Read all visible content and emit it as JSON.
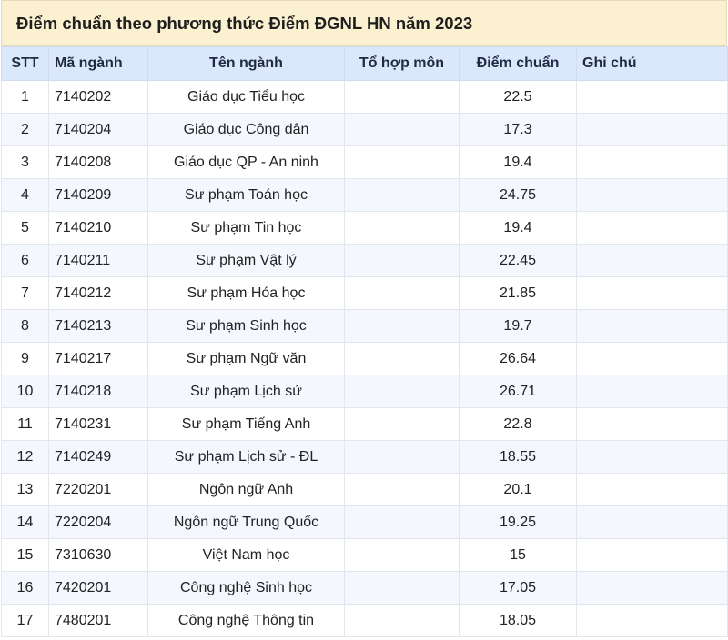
{
  "title": "Điểm chuẩn theo phương thức Điểm ĐGNL HN năm 2023",
  "columns": [
    "STT",
    "Mã ngành",
    "Tên ngành",
    "Tổ hợp môn",
    "Điểm chuẩn",
    "Ghi chú"
  ],
  "rows": [
    {
      "stt": "1",
      "code": "7140202",
      "name": "Giáo dục Tiểu học",
      "combo": "",
      "score": "22.5",
      "note": ""
    },
    {
      "stt": "2",
      "code": "7140204",
      "name": "Giáo dục Công dân",
      "combo": "",
      "score": "17.3",
      "note": ""
    },
    {
      "stt": "3",
      "code": "7140208",
      "name": "Giáo dục QP - An ninh",
      "combo": "",
      "score": "19.4",
      "note": ""
    },
    {
      "stt": "4",
      "code": "7140209",
      "name": "Sư phạm Toán học",
      "combo": "",
      "score": "24.75",
      "note": ""
    },
    {
      "stt": "5",
      "code": "7140210",
      "name": "Sư phạm Tin học",
      "combo": "",
      "score": "19.4",
      "note": ""
    },
    {
      "stt": "6",
      "code": "7140211",
      "name": "Sư phạm Vật lý",
      "combo": "",
      "score": "22.45",
      "note": ""
    },
    {
      "stt": "7",
      "code": "7140212",
      "name": "Sư phạm Hóa học",
      "combo": "",
      "score": "21.85",
      "note": ""
    },
    {
      "stt": "8",
      "code": "7140213",
      "name": "Sư phạm Sinh học",
      "combo": "",
      "score": "19.7",
      "note": ""
    },
    {
      "stt": "9",
      "code": "7140217",
      "name": "Sư phạm Ngữ văn",
      "combo": "",
      "score": "26.64",
      "note": ""
    },
    {
      "stt": "10",
      "code": "7140218",
      "name": "Sư phạm Lịch sử",
      "combo": "",
      "score": "26.71",
      "note": ""
    },
    {
      "stt": "11",
      "code": "7140231",
      "name": "Sư phạm Tiếng Anh",
      "combo": "",
      "score": "22.8",
      "note": ""
    },
    {
      "stt": "12",
      "code": "7140249",
      "name": "Sư phạm Lịch sử - ĐL",
      "combo": "",
      "score": "18.55",
      "note": ""
    },
    {
      "stt": "13",
      "code": "7220201",
      "name": "Ngôn ngữ Anh",
      "combo": "",
      "score": "20.1",
      "note": ""
    },
    {
      "stt": "14",
      "code": "7220204",
      "name": "Ngôn ngữ Trung Quốc",
      "combo": "",
      "score": "19.25",
      "note": ""
    },
    {
      "stt": "15",
      "code": "7310630",
      "name": "Việt Nam học",
      "combo": "",
      "score": "15",
      "note": ""
    },
    {
      "stt": "16",
      "code": "7420201",
      "name": "Công nghệ Sinh học",
      "combo": "",
      "score": "17.05",
      "note": ""
    },
    {
      "stt": "17",
      "code": "7480201",
      "name": "Công nghệ Thông tin",
      "combo": "",
      "score": "18.05",
      "note": ""
    }
  ]
}
